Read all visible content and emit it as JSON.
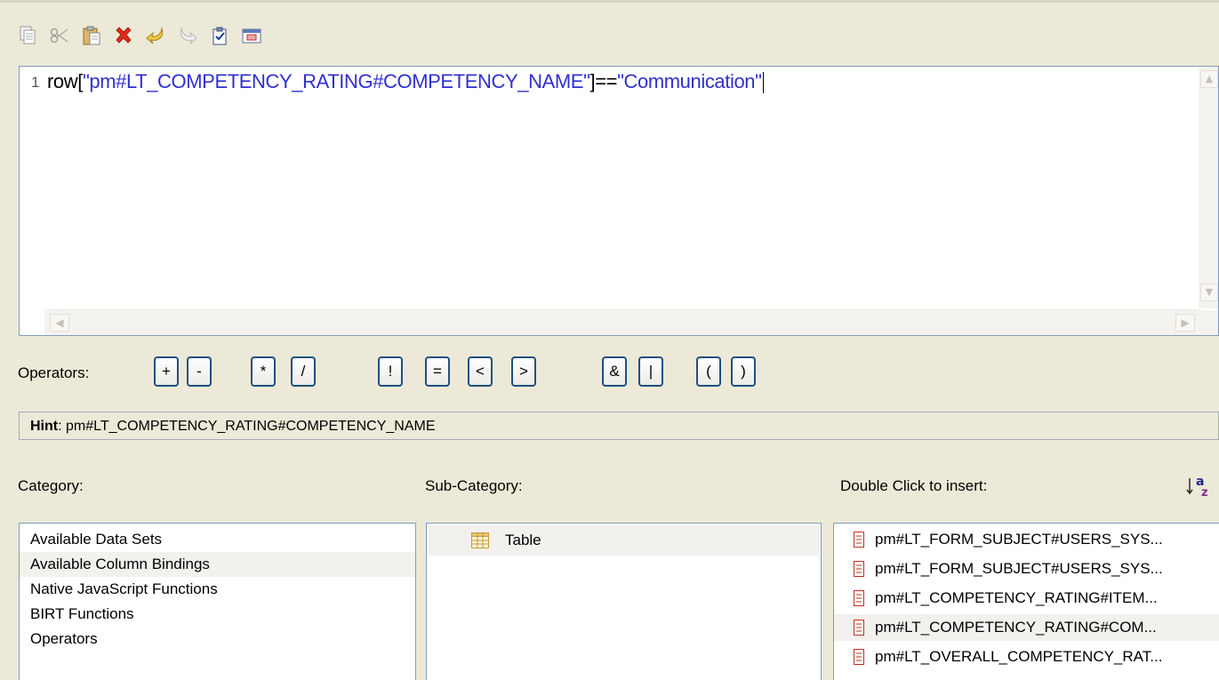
{
  "toolbar": {
    "buttons": [
      "copy-icon",
      "cut-icon",
      "paste-icon",
      "delete-icon",
      "undo-icon",
      "redo-icon",
      "validate-icon",
      "calendar-icon"
    ]
  },
  "editor": {
    "line_number": "1",
    "code_prefix": "row[",
    "code_string": "\"pm#LT_COMPETENCY_RATING#COMPETENCY_NAME\"",
    "code_op": "]==",
    "code_value": "\"Communication\""
  },
  "operators": {
    "label": "Operators:",
    "buttons": [
      "+",
      "-",
      "*",
      "/",
      "!",
      "=",
      "<",
      ">",
      "&",
      "|",
      "(",
      ")"
    ]
  },
  "hint": {
    "label": "Hint",
    "text": ": pm#LT_COMPETENCY_RATING#COMPETENCY_NAME"
  },
  "category": {
    "label": "Category:",
    "items": [
      "Available Data Sets",
      "Available Column Bindings",
      "Native JavaScript Functions",
      "BIRT Functions",
      "Operators"
    ],
    "selected": "Available Column Bindings"
  },
  "sub_category": {
    "label": "Sub-Category:",
    "items": [
      "Table"
    ]
  },
  "insert": {
    "label": "Double Click to insert:",
    "items": [
      "pm#LT_FORM_SUBJECT#USERS_SYS...",
      "pm#LT_FORM_SUBJECT#USERS_SYS...",
      "pm#LT_COMPETENCY_RATING#ITEM...",
      "pm#LT_COMPETENCY_RATING#COM...",
      "pm#LT_OVERALL_COMPETENCY_RAT..."
    ],
    "selected_index": 3
  },
  "colors": {
    "string_blue": "#3030d0",
    "button_border": "#1c5180",
    "column_icon": "#c03020"
  }
}
